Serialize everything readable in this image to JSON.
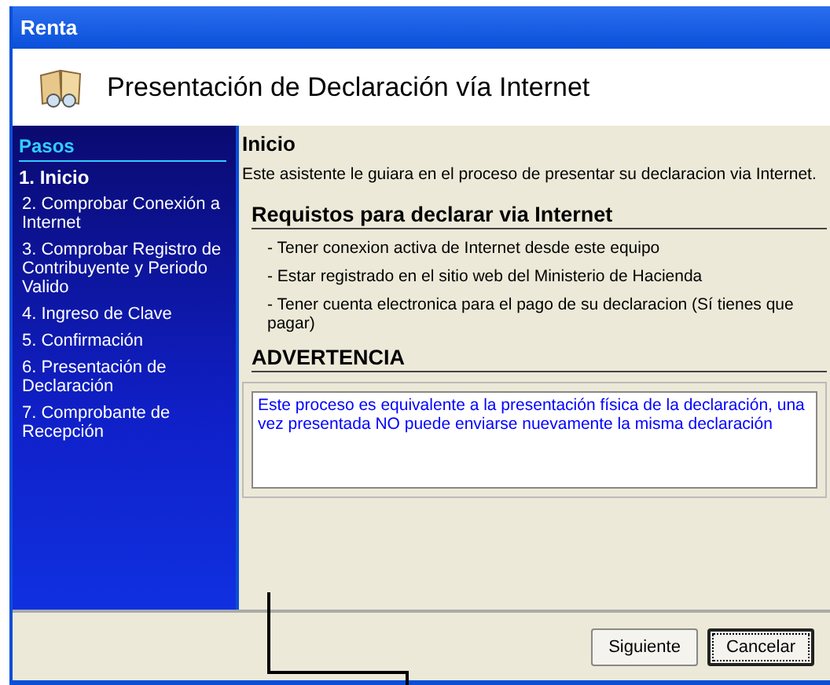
{
  "window": {
    "title": "Renta"
  },
  "header": {
    "title": "Presentación de Declaración vía Internet"
  },
  "sidebar": {
    "title": "Pasos",
    "items": [
      {
        "label": "1. Inicio",
        "selected": true
      },
      {
        "label": "2. Comprobar Conexión a Internet",
        "selected": false
      },
      {
        "label": "3. Comprobar Registro de Contribuyente y Periodo Valido",
        "selected": false
      },
      {
        "label": "4. Ingreso de Clave",
        "selected": false
      },
      {
        "label": "5. Confirmación",
        "selected": false
      },
      {
        "label": "6. Presentación de Declaración",
        "selected": false
      },
      {
        "label": "7. Comprobante de Recepción",
        "selected": false
      }
    ]
  },
  "content": {
    "title": "Inicio",
    "intro": "Este asistente le guiara en el proceso de presentar su declaracion via Internet.",
    "requirements_title": "Requistos para declarar via Internet",
    "requirements": [
      "- Tener conexion activa de Internet desde este equipo",
      "- Estar registrado en el sitio web del Ministerio de Hacienda",
      "- Tener cuenta electronica para el pago de su declaracion (Sí tienes que pagar)"
    ],
    "warning_title": "ADVERTENCIA",
    "warning_text": "Este proceso es equivalente a la presentación física de la declaración, una vez presentada NO puede enviarse nuevamente la misma declaración"
  },
  "buttons": [
    {
      "label": "Siguiente",
      "kind": "normal"
    },
    {
      "label": "Cancelar",
      "kind": "default"
    }
  ]
}
